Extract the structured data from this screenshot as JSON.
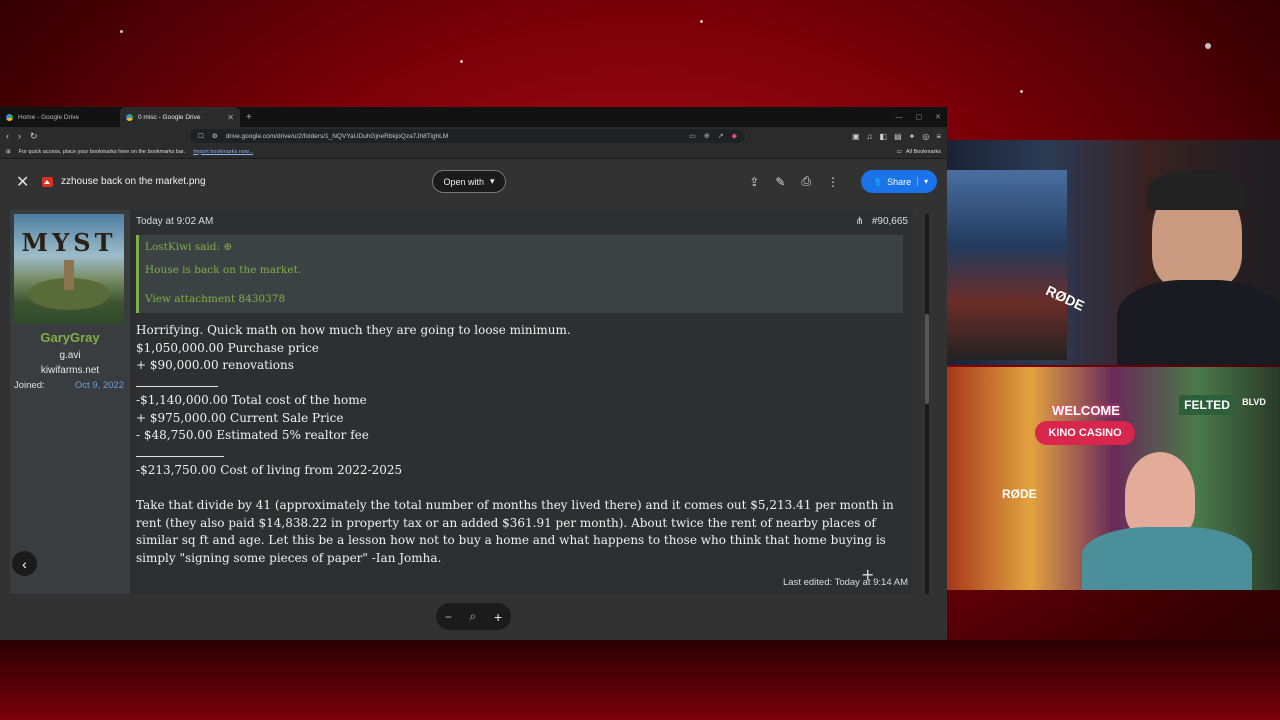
{
  "browser": {
    "tabs": [
      {
        "title": "Home - Google Drive",
        "active": false
      },
      {
        "title": "0 misc - Google Drive",
        "active": true
      }
    ],
    "url": "drive.google.com/drive/u/2/folders/1_NQVYaUDuhGjneRbkjoQza7Jh8TighLM",
    "bookmarks_prompt": "For quick access, place your bookmarks here on the bookmarks bar.",
    "bookmarks_import": "Import bookmarks now...",
    "all_bookmarks": "All Bookmarks"
  },
  "viewer": {
    "filename": "zzhouse back on the market.png",
    "open_with": "Open with",
    "share": "Share",
    "zoom_minus": "−",
    "zoom_plus": "+"
  },
  "post": {
    "avatar_text": "MYST",
    "username": "GaryGray",
    "user_title": "g.avi",
    "user_site": "kiwifarms.net",
    "joined_label": "Joined:",
    "joined_date": "Oct 9, 2022",
    "timestamp": "Today at 9:02 AM",
    "post_number": "#90,665",
    "quote_author": "LostKiwi said: ⊕",
    "quote_text": "House is back on the market.",
    "quote_attachment": "View attachment 8430378",
    "lines": [
      "Horrifying. Quick math on how much they are going to loose minimum.",
      "$1,050,000.00 Purchase price",
      "+ $90,000.00 renovations",
      "-$1,140,000.00 Total cost of the home",
      "+ $975,000.00 Current Sale Price",
      "- $48,750.00 Estimated 5% realtor fee",
      "-$213,750.00 Cost of living from 2022-2025",
      "Take that divide by 41 (approximately the total number of months they lived there) and it comes out $5,213.41 per month in rent (they also paid $14,838.22 in property tax or an added $361.91 per month). About twice the rent of nearby places of similar sq ft and age. Let this be a lesson how not to buy a home and what happens to those who think that home buying is simply \"signing some pieces of paper\" -Ian Jomha."
    ],
    "last_edited": "Last edited: Today at 9:14 AM"
  },
  "stream": {
    "sign_welcome": "WELCOME",
    "sign_casino": "KINO CASINO",
    "sign_felted": "FELTED",
    "sign_blvd": "BLVD",
    "mic_brand_1": "RØDE",
    "mic_brand_2": "RØDE"
  },
  "colors": {
    "accent_green": "#7fb045",
    "share_blue": "#1a73e8",
    "link_blue": "#6a9fd8",
    "background_red": "#b0101a"
  }
}
